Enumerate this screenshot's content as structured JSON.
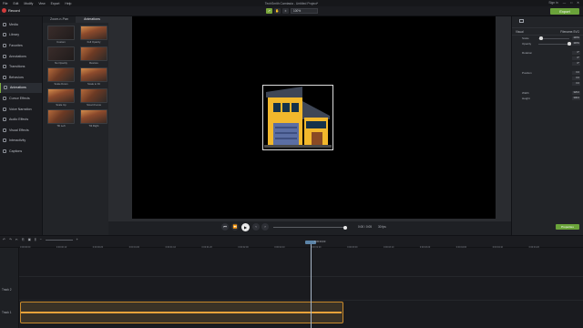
{
  "window": {
    "title": "TechSmith Camtasia - Untitled Project*",
    "menu": [
      "File",
      "Edit",
      "Modify",
      "View",
      "Export",
      "Help"
    ],
    "right_items": [
      "Sign in",
      "—",
      "□",
      "✕"
    ]
  },
  "toolbar": {
    "record_label": "Record",
    "zoom_value": "100%",
    "export_label": "Export"
  },
  "sidebar": {
    "items": [
      {
        "label": "Media"
      },
      {
        "label": "Library"
      },
      {
        "label": "Favorites"
      },
      {
        "label": "Annotations"
      },
      {
        "label": "Transitions"
      },
      {
        "label": "Behaviors"
      },
      {
        "label": "Animations"
      },
      {
        "label": "Cursor Effects"
      },
      {
        "label": "Voice Narration"
      },
      {
        "label": "Audio Effects"
      },
      {
        "label": "Visual Effects"
      },
      {
        "label": "Interactivity"
      },
      {
        "label": "Captions"
      }
    ],
    "active_index": 6
  },
  "library": {
    "tabs": [
      "Zoom-n-Pan",
      "Animations"
    ],
    "active_tab": 1,
    "thumbs": [
      {
        "caption": "Custom"
      },
      {
        "caption": "Full Opacity"
      },
      {
        "caption": "No Opacity"
      },
      {
        "caption": "Restore"
      },
      {
        "caption": "Scale Down"
      },
      {
        "caption": "Scale to Fit"
      },
      {
        "caption": "Scale Up"
      },
      {
        "caption": "Smart Focus"
      },
      {
        "caption": "Tilt Left"
      },
      {
        "caption": "Tilt Right"
      }
    ]
  },
  "playback": {
    "time": "0:00 / 0:05",
    "fps": "30 fps"
  },
  "properties": {
    "head_tabs": [
      "Visual",
      "Filename.SVG"
    ],
    "rows": [
      {
        "label": "Scale",
        "value": "100%",
        "level": 0.1
      },
      {
        "label": "Opacity",
        "value": "100%",
        "level": 1.0
      },
      {
        "label": "Rotation",
        "value": "0°",
        "level": null
      },
      {
        "label": "",
        "value": "0°",
        "level": null
      },
      {
        "label": "",
        "value": "0°",
        "level": null
      },
      {
        "label": "Position",
        "value": "0.0",
        "level": null
      },
      {
        "label": "",
        "value": "0.0",
        "level": null
      },
      {
        "label": "",
        "value": "0.0",
        "level": null
      },
      {
        "label": "Width",
        "value": "326.0",
        "level": null
      },
      {
        "label": "Height",
        "value": "300.0",
        "level": null
      }
    ],
    "button_label": "Properties"
  },
  "timeline": {
    "ticks": [
      "0:00:00;00",
      "0:00:00;10",
      "0:00:00;20",
      "0:00:01;00",
      "0:00:01;10",
      "0:00:01;20",
      "0:00:02;00",
      "0:00:02;10",
      "0:00:02;20",
      "0:00:03;00",
      "0:00:03;10",
      "0:00:03;20",
      "0:00:04;00",
      "0:00:04;10",
      "0:00:04;20"
    ],
    "playhead_time": "0:00:03;00",
    "tracks": [
      "Track 2",
      "Track 1"
    ]
  },
  "colors": {
    "accent": "#6aa33a",
    "clip_border": "#c98a2c",
    "clip_line": "#e8a23a",
    "playhead": "#5c84a8"
  }
}
